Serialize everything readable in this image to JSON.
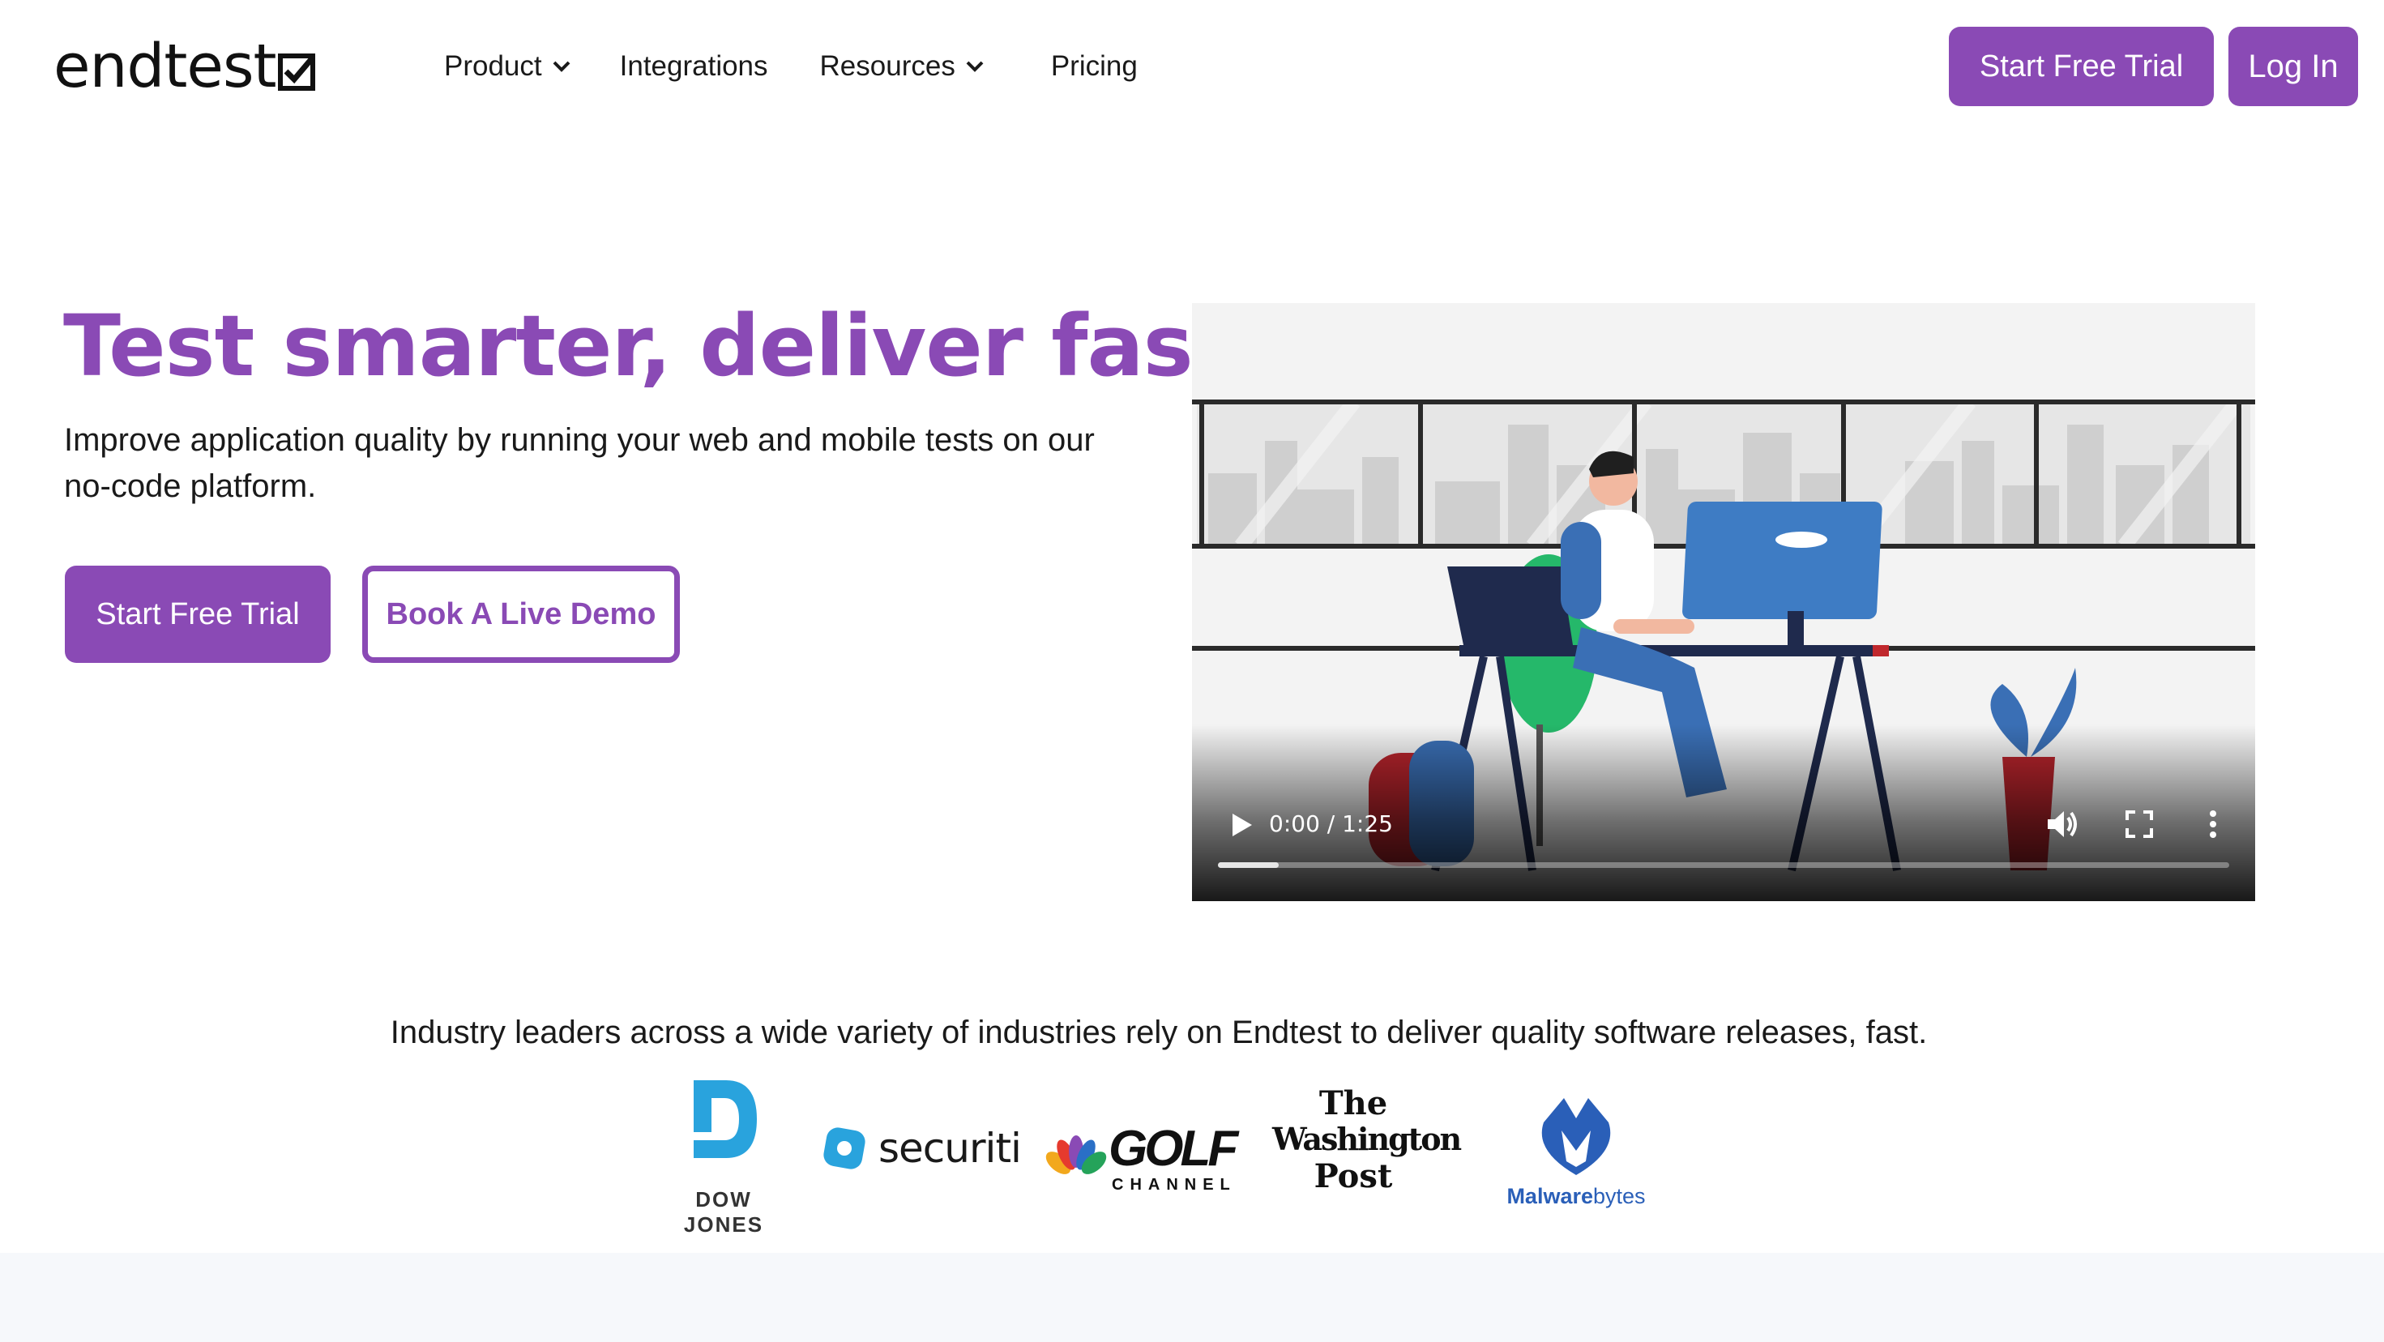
{
  "brand": {
    "name": "endtest",
    "accent": "#8a4ab5"
  },
  "nav": {
    "items": [
      {
        "label": "Product",
        "dropdown": true
      },
      {
        "label": "Integrations",
        "dropdown": false
      },
      {
        "label": "Resources",
        "dropdown": true
      },
      {
        "label": "Pricing",
        "dropdown": false
      }
    ],
    "cta_label": "Start Free Trial",
    "login_label": "Log In"
  },
  "hero": {
    "title": "Test smarter, deliver faster.",
    "subtitle": "Improve application quality by running your web and mobile tests on our no-code platform.",
    "primary_label": "Start Free Trial",
    "secondary_label": "Book A Live Demo"
  },
  "video": {
    "time": "0:00 / 1:25",
    "progress": 0.06
  },
  "trust": {
    "text": "Industry leaders across a wide variety of industries rely on Endtest to deliver quality software releases, fast.",
    "logos": [
      {
        "name": "DOW JONES"
      },
      {
        "name": "securiti"
      },
      {
        "name": "GOLF",
        "sub": "CHANNEL"
      },
      {
        "name_line1": "The",
        "name_line2": "Washington",
        "name_line3": "Post"
      },
      {
        "name_part1": "Malware",
        "name_part2": "bytes"
      }
    ]
  }
}
